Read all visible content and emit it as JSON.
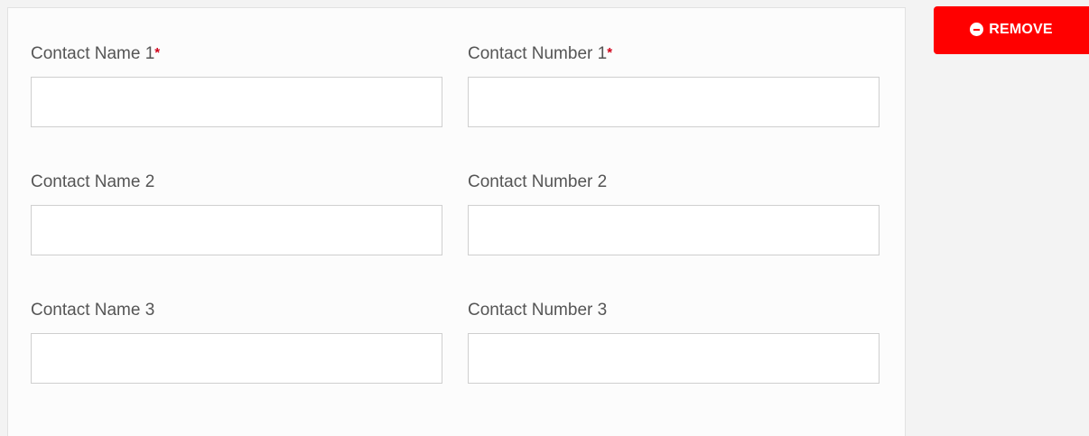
{
  "remove_button": {
    "label": "REMOVE",
    "icon": "minus-circle-icon",
    "color": "#ff0000"
  },
  "required_marker": "*",
  "required_color": "#d0021b",
  "contacts": [
    {
      "name_label": "Contact Name 1",
      "name_required": true,
      "name_value": "",
      "number_label": "Contact Number 1",
      "number_required": true,
      "number_value": ""
    },
    {
      "name_label": "Contact Name 2",
      "name_required": false,
      "name_value": "",
      "number_label": "Contact Number 2",
      "number_required": false,
      "number_value": ""
    },
    {
      "name_label": "Contact Name 3",
      "name_required": false,
      "name_value": "",
      "number_label": "Contact Number 3",
      "number_required": false,
      "number_value": ""
    }
  ]
}
